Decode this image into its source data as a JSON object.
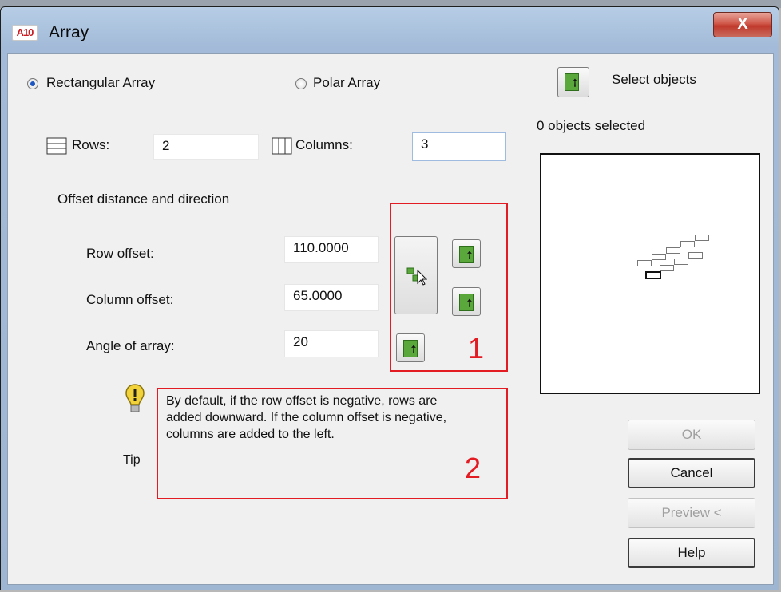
{
  "window": {
    "title": "Array",
    "app_icon_text": "A10",
    "close_label": "X"
  },
  "array_type": {
    "rectangular_label": "Rectangular Array",
    "polar_label": "Polar Array",
    "selected": "rectangular"
  },
  "select_objects": {
    "label": "Select objects",
    "status": "0 objects selected"
  },
  "rows": {
    "label": "Rows:",
    "value": "2"
  },
  "columns": {
    "label": "Columns:",
    "value": "3"
  },
  "offset": {
    "section_title": "Offset distance and direction",
    "row_offset_label": "Row offset:",
    "row_offset_value": "110.0000",
    "column_offset_label": "Column offset:",
    "column_offset_value": "65.0000",
    "angle_label": "Angle of array:",
    "angle_value": "20"
  },
  "tip": {
    "label": "Tip",
    "text": "By default, if the row offset is negative, rows are added downward.  If the column offset is negative, columns are added to the left."
  },
  "annotations": {
    "box1": "1",
    "box2": "2"
  },
  "buttons": {
    "ok": "OK",
    "cancel": "Cancel",
    "preview": "Preview <",
    "help": "Help"
  },
  "colors": {
    "annotation_red": "#e31b23",
    "pick_green": "#5aa83c",
    "close_red": "#c0392b"
  }
}
